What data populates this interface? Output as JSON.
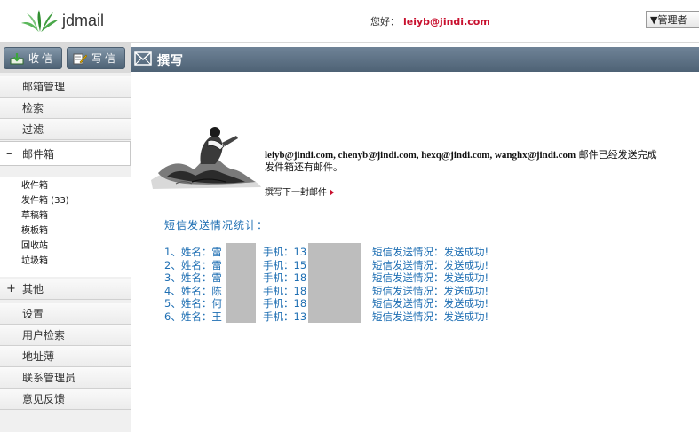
{
  "app": {
    "brand": "jdmail"
  },
  "header": {
    "greeting": "您好：",
    "user_email": "leiyb@jindi.com",
    "admin_dropdown": "▼管理者"
  },
  "toolbar": {
    "receive_label": "收信",
    "compose_label": "写信"
  },
  "sidebar": {
    "top_items": [
      "邮箱管理",
      "检索",
      "过滤"
    ],
    "mailbox": {
      "sign": "–",
      "label": "邮件箱",
      "folders": [
        "收件箱",
        "发件箱 (33)",
        "草稿箱",
        "模板箱",
        "回收站",
        "垃圾箱"
      ]
    },
    "other": {
      "sign": "+",
      "label": "其他"
    },
    "bottom_items": [
      "设置",
      "用户检索",
      "地址薄",
      "联系管理员",
      "意见反馈"
    ]
  },
  "main": {
    "title": "撰写",
    "sent_recipients": "leiyb@jindi.com, chenyb@jindi.com, hexq@jindi.com, wanghx@jindi.com",
    "sent_suffix": " 邮件已经发送完成",
    "outbox_note": "发件箱还有邮件。",
    "next_link": "撰写下一封邮件",
    "sms_title": "短信发送情况统计：",
    "sms_rows": [
      {
        "prefix": "1、姓名：雷",
        "phone": "手机：13",
        "status": "短信发送情况：发送成功!"
      },
      {
        "prefix": "2、姓名：雷",
        "phone": "手机：15",
        "status": "短信发送情况：发送成功!"
      },
      {
        "prefix": "3、姓名：雷",
        "phone": "手机：18",
        "status": "短信发送情况：发送成功!"
      },
      {
        "prefix": "4、姓名：陈",
        "phone": "手机：18",
        "status": "短信发送情况：发送成功!"
      },
      {
        "prefix": "5、姓名：何",
        "phone": "手机：18",
        "status": "短信发送情况：发送成功!"
      },
      {
        "prefix": "6、姓名：王",
        "phone": "手机：13",
        "status": "短信发送情况：发送成功!"
      }
    ]
  }
}
